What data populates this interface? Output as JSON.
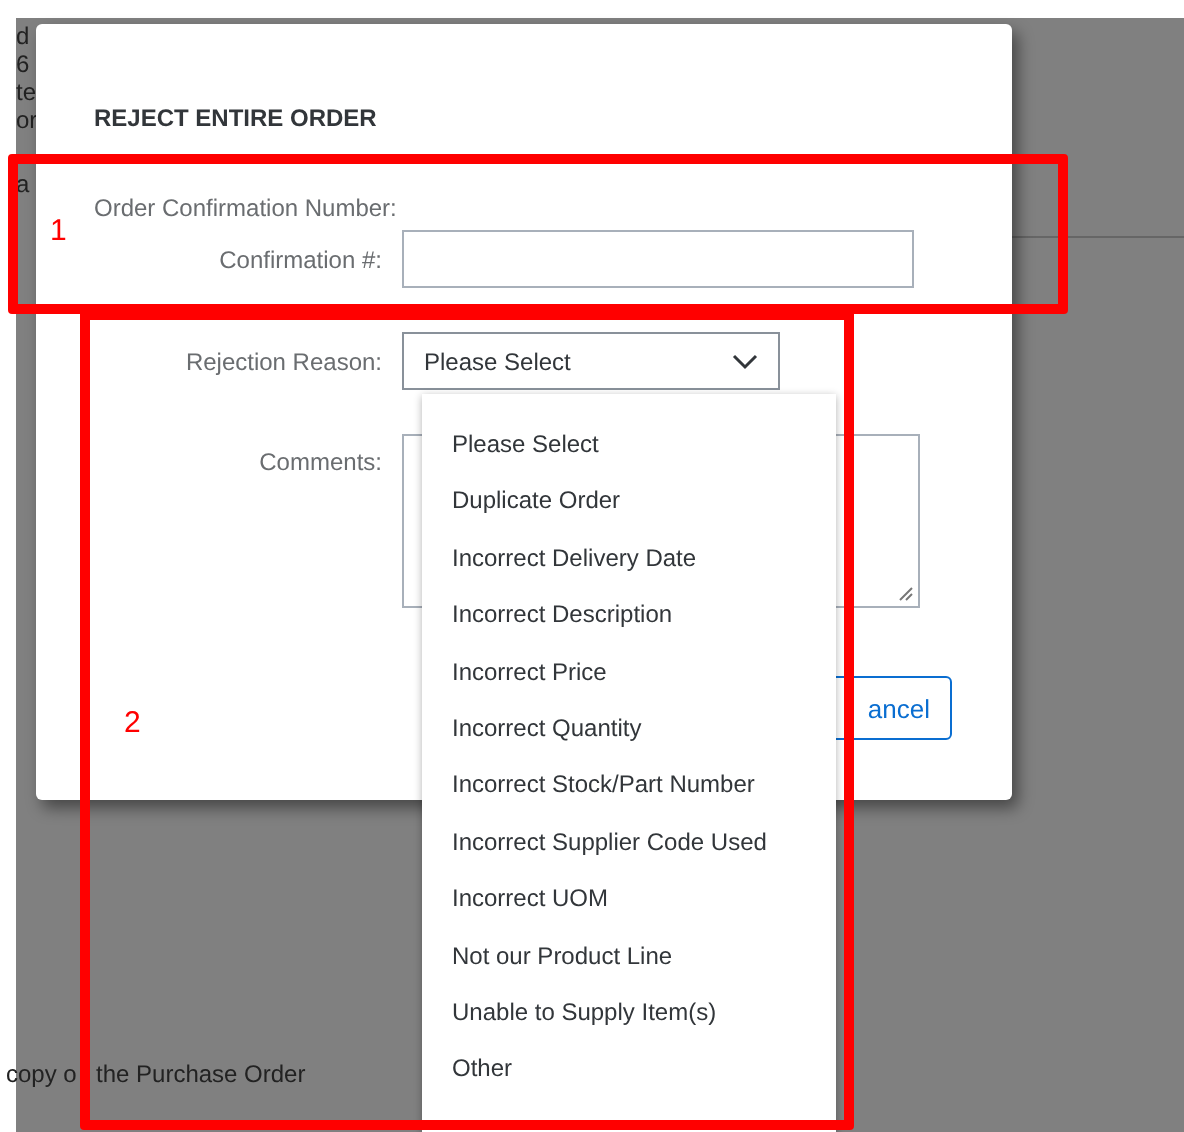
{
  "background": {
    "fragments": [
      "d",
      "6",
      "te",
      "or",
      "a"
    ],
    "footer_parts": [
      "copy o",
      "the Purchase Order"
    ]
  },
  "dialog": {
    "title": "REJECT ENTIRE ORDER",
    "section_label": "Order Confirmation Number:",
    "confirmation_label": "Confirmation #:",
    "rejection_label": "Rejection Reason:",
    "rejection_value": "Please Select",
    "comments_label": "Comments:",
    "cancel_button": "ancel"
  },
  "dropdown": {
    "options": [
      "Please Select",
      "Duplicate Order",
      "Incorrect Delivery Date",
      "Incorrect Description",
      "Incorrect Price",
      "Incorrect Quantity",
      "Incorrect Stock/Part Number",
      "Incorrect Supplier Code Used",
      "Incorrect UOM",
      "Not our Product Line",
      "Unable to Supply Item(s)",
      "Other"
    ]
  },
  "annotations": [
    {
      "label": "1"
    },
    {
      "label": "2"
    }
  ]
}
